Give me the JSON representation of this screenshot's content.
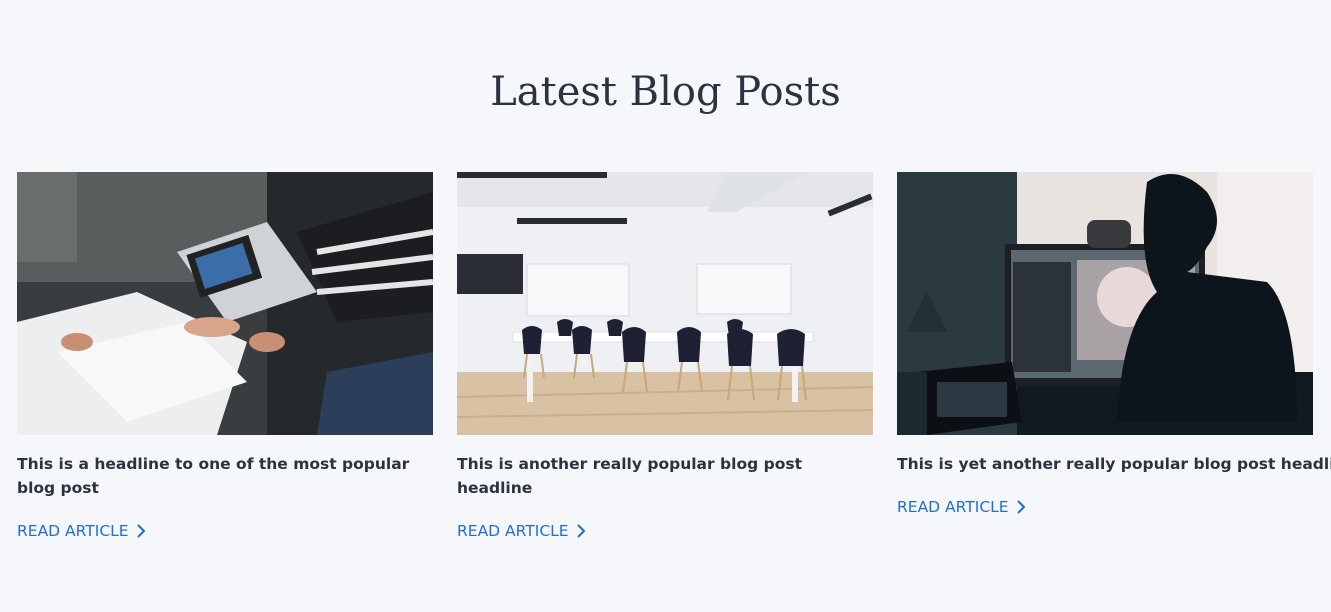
{
  "section": {
    "title": "Latest Blog Posts"
  },
  "posts": [
    {
      "headline": "This is a headline to one of the most popular blog post",
      "cta": "READ ARTICLE",
      "icon": "chevron-right-icon"
    },
    {
      "headline": "This is another really popular blog post headline",
      "cta": "READ ARTICLE",
      "icon": "chevron-right-icon"
    },
    {
      "headline": "This is yet another really popular blog post headline",
      "cta": "READ ARTICLE",
      "icon": "chevron-right-icon"
    }
  ],
  "colors": {
    "background": "#f6f7fb",
    "text": "#2b3340",
    "link": "#1f6fd6"
  }
}
